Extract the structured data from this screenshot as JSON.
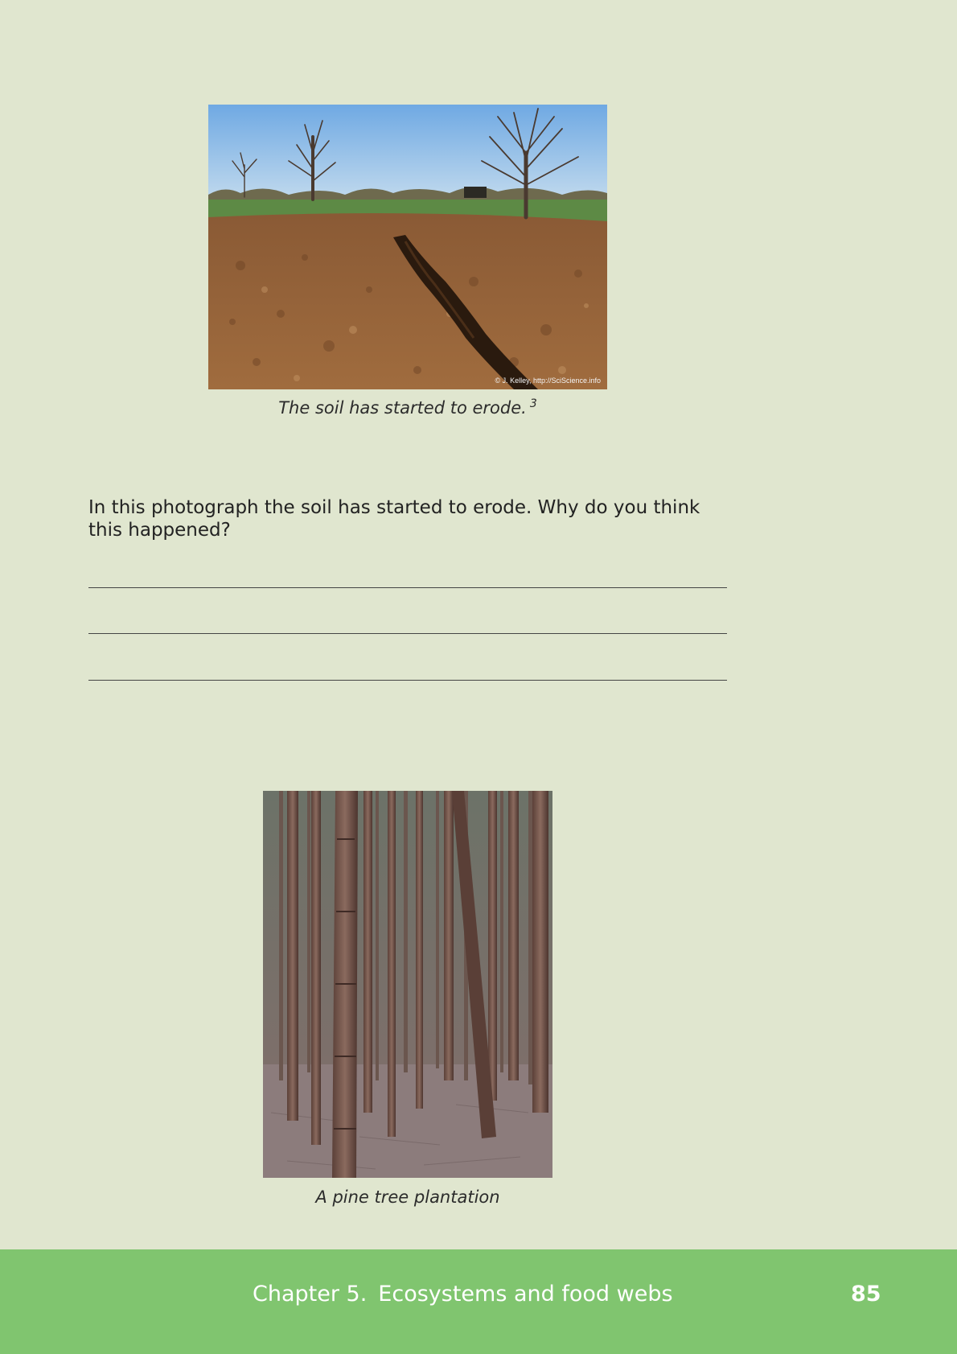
{
  "figures": [
    {
      "caption": "The soil has started to erode.",
      "footnote": "3",
      "credit": "© J. Kelley, http://SciScience.info"
    },
    {
      "caption": "A pine tree plantation"
    }
  ],
  "question": {
    "text": "In this photograph the soil has started to erode. Why do you think this happened?",
    "answer_lines": 3
  },
  "footer": {
    "chapter_number": "Chapter 5.",
    "chapter_title": "Ecosystems and food webs",
    "page_number": "85",
    "background_color": "#80c56f"
  }
}
